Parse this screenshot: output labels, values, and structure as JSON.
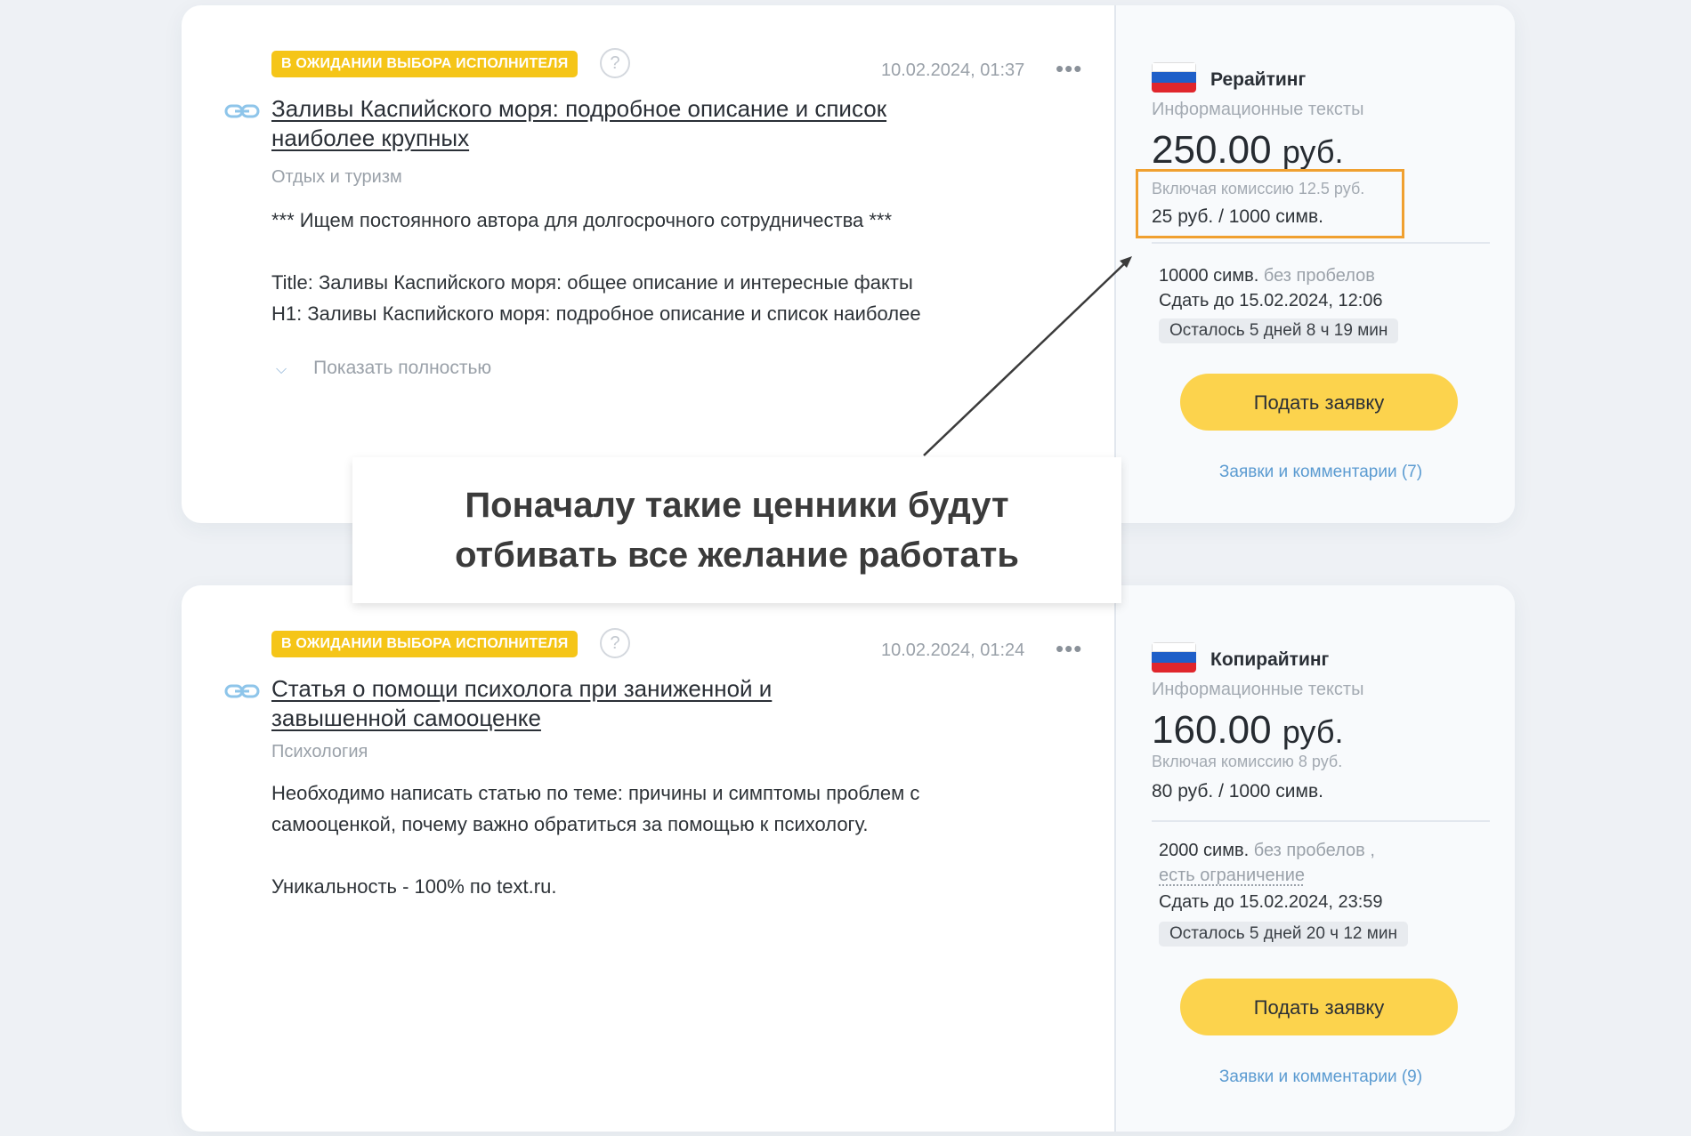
{
  "orders": [
    {
      "status": "В ожидании выбора исполнителя",
      "help": "?",
      "date": "10.02.2024, 01:37",
      "title": "Заливы Каспийского моря: подробное описание и список наиболее крупных",
      "category": "Отдых и туризм",
      "description": [
        "*** Ищем постоянного автора для долгосрочного сотрудничества ***",
        "",
        "Title: Заливы Каспийского моря: общее описание и интересные факты",
        "H1: Заливы Каспийского моря: подробное описание и список наиболее"
      ],
      "show_more": "Показать полностью",
      "side": {
        "type": "Рерайтинг",
        "subtype": "Информационные тексты",
        "price": "250.00",
        "currency": "руб.",
        "commission": "Включая комиссию 12.5 руб.",
        "rate": "25 руб. / 1000 симв.",
        "length": "10000 симв.",
        "length_note": "без пробелов",
        "deadline": "Сдать до 15.02.2024, 12:06",
        "remaining": "Осталось 5 дней 8 ч 19 мин",
        "apply": "Подать заявку",
        "comments": "Заявки и комментарии (7)"
      }
    },
    {
      "status": "В ожидании выбора исполнителя",
      "help": "?",
      "date": "10.02.2024, 01:24",
      "title": "Статья о помощи психолога при заниженной и завышенной самооценке",
      "category": "Психология",
      "description": [
        "Необходимо написать статью по теме: причины и симптомы проблем с",
        "самооценкой, почему важно обратиться за помощью к психологу.",
        "",
        "Уникальность - 100% по text.ru."
      ],
      "side": {
        "type": "Копирайтинг",
        "subtype": "Информационные тексты",
        "price": "160.00",
        "currency": "руб.",
        "commission": "Включая комиссию 8 руб.",
        "rate": "80 руб. / 1000 симв.",
        "length": "2000 симв.",
        "length_note": "без пробелов ,",
        "restriction": "есть ограничение",
        "deadline": "Сдать до 15.02.2024, 23:59",
        "remaining": "Осталось 5 дней 20 ч 12 мин",
        "apply": "Подать заявку",
        "comments": "Заявки и комментарии (9)"
      }
    }
  ],
  "annotation": {
    "line1": "Поначалу такие ценники будут",
    "line2": "отбивать все желание работать"
  },
  "colors": {
    "badge": "#f5c518",
    "button": "#fcd34d",
    "highlight": "#f0a030",
    "link": "#5b9bd1"
  }
}
